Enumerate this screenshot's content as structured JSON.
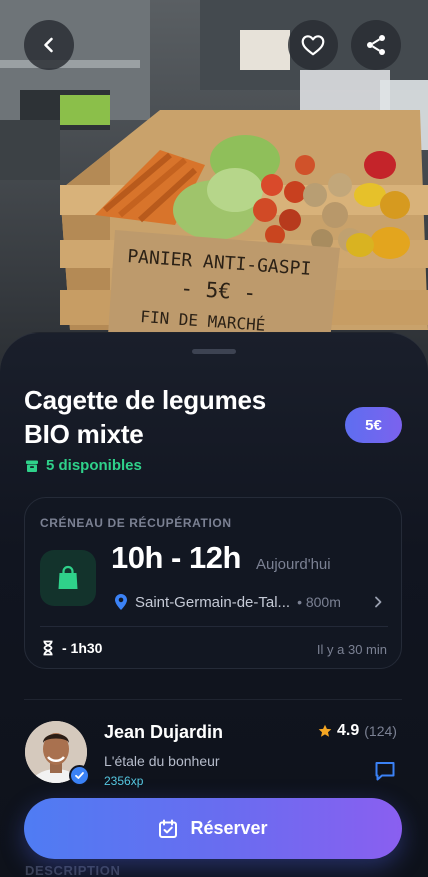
{
  "hero": {
    "sign_lines": [
      "PANIER ANTI-GASPI",
      "- 5€ -",
      "FIN DE MARCHÉ"
    ],
    "back_icon": "chevron-left-icon",
    "favorite_icon": "heart-icon",
    "share_icon": "share-icon"
  },
  "offer": {
    "title_line1": "Cagette de legumes",
    "title_line2": "BIO mixte",
    "price": "5€",
    "stock": "5 disponibles"
  },
  "pickup": {
    "label": "CRÉNEAU DE RÉCUPÉRATION",
    "time_range": "10h - 12h",
    "day": "Aujourd'hui",
    "location": "Saint-Germain-de-Tal...",
    "distance": "• 800m",
    "countdown": "- 1h30",
    "posted": "Il y a 30 min"
  },
  "seller": {
    "name": "Jean Dujardin",
    "shop": "L'étale du bonheur",
    "xp": "2356xp",
    "rating": "4.9",
    "reviews": "(124)"
  },
  "description_label": "DESCRIPTION",
  "cta": {
    "label": "Réserver"
  },
  "colors": {
    "accent_green": "#2fd18a",
    "accent_blue": "#5e6ef0",
    "accent_purple": "#8a5ff0",
    "star": "#f5a623",
    "background": "#0e121b"
  }
}
